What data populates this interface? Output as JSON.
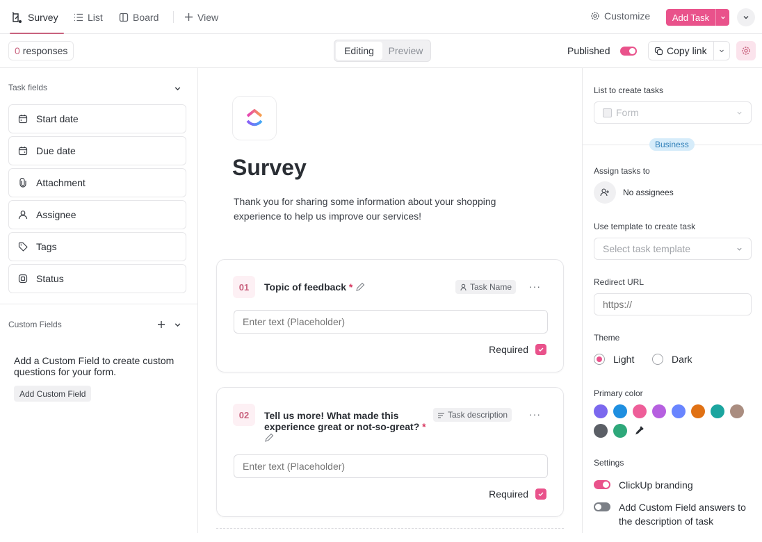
{
  "topbar": {
    "tabs": [
      {
        "label": "Survey",
        "icon": "form-icon",
        "active": true
      },
      {
        "label": "List",
        "icon": "list-icon",
        "active": false
      },
      {
        "label": "Board",
        "icon": "board-icon",
        "active": false
      }
    ],
    "add_view_label": "View",
    "customize_label": "Customize",
    "add_task_label": "Add Task"
  },
  "subbar": {
    "responses_count": "0",
    "responses_label": "responses",
    "mode_options": [
      "Editing",
      "Preview"
    ],
    "mode_selected": "Editing",
    "published_label": "Published",
    "published_on": true,
    "copy_link_label": "Copy link"
  },
  "left_panel": {
    "task_fields_title": "Task fields",
    "task_fields": [
      {
        "label": "Start date",
        "icon": "calendar-start-icon"
      },
      {
        "label": "Due date",
        "icon": "calendar-due-icon"
      },
      {
        "label": "Attachment",
        "icon": "paperclip-icon"
      },
      {
        "label": "Assignee",
        "icon": "user-icon"
      },
      {
        "label": "Tags",
        "icon": "tag-icon"
      },
      {
        "label": "Status",
        "icon": "status-icon"
      }
    ],
    "custom_fields_title": "Custom Fields",
    "custom_fields_empty_text": "Add a Custom Field to create custom questions for your form.",
    "add_custom_field_label": "Add Custom Field"
  },
  "form": {
    "title": "Survey",
    "description": "Thank you for sharing some information about your shopping experience to help us improve our services!",
    "questions": [
      {
        "number": "01",
        "title": "Topic of feedback",
        "required_mark": "*",
        "mapping_label": "Task Name",
        "mapping_icon": "task-name-icon",
        "placeholder": "Enter text (Placeholder)",
        "required_label": "Required",
        "required": true
      },
      {
        "number": "02",
        "title": "Tell us more! What made this experience great or not-so-great?",
        "required_mark": "*",
        "mapping_label": "Task description",
        "mapping_icon": "text-lines-icon",
        "placeholder": "Enter text (Placeholder)",
        "required_label": "Required",
        "required": true
      }
    ]
  },
  "right_panel": {
    "list_label": "List to create tasks",
    "list_value": "Form",
    "plan_badge": "Business",
    "assign_label": "Assign tasks to",
    "assignee_value": "No assignees",
    "template_label": "Use template to create task",
    "template_placeholder": "Select task template",
    "redirect_label": "Redirect URL",
    "redirect_placeholder": "https://",
    "theme_label": "Theme",
    "theme_options": [
      "Light",
      "Dark"
    ],
    "theme_selected": "Light",
    "primary_color_label": "Primary color",
    "colors": [
      "#7b68ee",
      "#1f8fe0",
      "#ee5e99",
      "#b660e0",
      "#6985ff",
      "#e07114",
      "#1ba59f",
      "#aa8d80",
      "#5b5f66",
      "#2ea87a"
    ],
    "settings_label": "Settings",
    "settings": [
      {
        "label": "ClickUp branding",
        "on": true
      },
      {
        "label": "Add Custom Field answers to the description of task",
        "on": false
      }
    ]
  },
  "colors": {
    "accent": "#e9528b",
    "accent_text": "#c9627e"
  }
}
